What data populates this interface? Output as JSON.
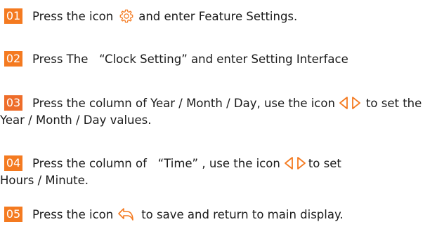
{
  "colors": {
    "badge_orange": "#f47a20",
    "badge_orange_light": "#ee6d2a",
    "icon_orange": "#f47a20"
  },
  "steps": [
    {
      "number": "01",
      "text_before": "Press the icon",
      "icon": "gear-icon",
      "text_after": "and enter Feature Settings."
    },
    {
      "number": "02",
      "text": "Press The   “Clock Setting” and enter Setting Interface"
    },
    {
      "number": "03",
      "text_before": "Press the column of Year / Month / Day, use the icon",
      "icons": [
        "triangle-left-icon",
        "triangle-right-icon"
      ],
      "text_after": "to set the",
      "continuation": "Year / Month / Day values."
    },
    {
      "number": "04",
      "text_before": "Press the column of   “Time” , use the icon",
      "icons": [
        "triangle-left-icon",
        "triangle-right-icon"
      ],
      "text_after": "to set",
      "continuation": "Hours / Minute."
    },
    {
      "number": "05",
      "text_before": "Press the icon",
      "icon": "back-arrow-icon",
      "text_after": "to save and return to main display."
    }
  ]
}
